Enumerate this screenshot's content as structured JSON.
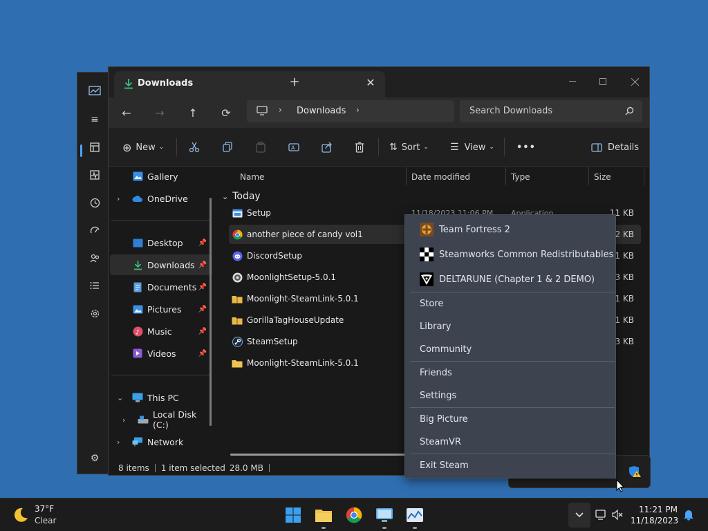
{
  "explorer": {
    "tab_title": "Downloads",
    "breadcrumb": [
      "Downloads"
    ],
    "search_placeholder": "Search Downloads",
    "toolbar": {
      "new_label": "New",
      "sort_label": "Sort",
      "view_label": "View",
      "more_label": "•••",
      "details_label": "Details"
    },
    "sidebar": {
      "top": [
        {
          "label": "Gallery",
          "icon": "gallery-icon"
        },
        {
          "label": "OneDrive",
          "icon": "cloud-icon"
        }
      ],
      "quick": [
        {
          "label": "Desktop",
          "icon": "desktop-icon"
        },
        {
          "label": "Downloads",
          "icon": "download-icon",
          "selected": true
        },
        {
          "label": "Documents",
          "icon": "document-icon"
        },
        {
          "label": "Pictures",
          "icon": "picture-icon"
        },
        {
          "label": "Music",
          "icon": "music-icon"
        },
        {
          "label": "Videos",
          "icon": "video-icon"
        }
      ],
      "bottom": [
        {
          "label": "This PC",
          "icon": "computer-icon"
        },
        {
          "label": "Local Disk (C:)",
          "icon": "drive-icon"
        },
        {
          "label": "Network",
          "icon": "network-icon"
        }
      ]
    },
    "columns": {
      "name": "Name",
      "date": "Date modified",
      "type": "Type",
      "size": "Size"
    },
    "group_label": "Today",
    "files": [
      {
        "name": "Setup",
        "size": "11 KB",
        "icon": "setup-icon",
        "date": "11/18/2023 11:06 PM",
        "type": "Application"
      },
      {
        "name": "another piece of candy vol1",
        "size": "762 KB",
        "icon": "chrome-icon",
        "selected": true
      },
      {
        "name": "DiscordSetup",
        "size": "931 KB",
        "icon": "discord-icon"
      },
      {
        "name": "MoonlightSetup-5.0.1",
        "size": "533 KB",
        "icon": "moonlight-icon"
      },
      {
        "name": "Moonlight-SteamLink-5.0.1",
        "size": "401 KB",
        "icon": "zip-folder-icon"
      },
      {
        "name": "GorillaTagHouseUpdate",
        "size": "1 KB",
        "icon": "zip-folder-icon"
      },
      {
        "name": "SteamSetup",
        "size": "243 KB",
        "icon": "steam-icon"
      },
      {
        "name": "Moonlight-SteamLink-5.0.1",
        "size": "",
        "icon": "folder-icon"
      }
    ],
    "status": {
      "items": "8 items",
      "selected": "1 item selected",
      "size": "28.0 MB"
    }
  },
  "steam_menu": {
    "games": [
      {
        "label": "Team Fortress 2",
        "icon": "tf2-icon"
      },
      {
        "label": "Steamworks Common Redistributables",
        "icon": "steamworks-icon"
      },
      {
        "label": "DELTARUNE (Chapter 1 & 2 DEMO)",
        "icon": "deltarune-icon"
      }
    ],
    "nav": [
      "Store",
      "Library",
      "Community"
    ],
    "social": [
      "Friends",
      "Settings"
    ],
    "modes": [
      "Big Picture",
      "SteamVR"
    ],
    "exit": "Exit Steam"
  },
  "taskbar": {
    "weather": {
      "temp": "37°F",
      "desc": "Clear"
    },
    "clock": {
      "time": "11:21 PM",
      "date": "11/18/2023"
    }
  },
  "colors": {
    "desktop": "#2f6fb1",
    "explorer_bg": "#191919",
    "menu_bg": "#3d4450",
    "accent": "#4aa3ff",
    "download_green": "#3fbf7f"
  }
}
